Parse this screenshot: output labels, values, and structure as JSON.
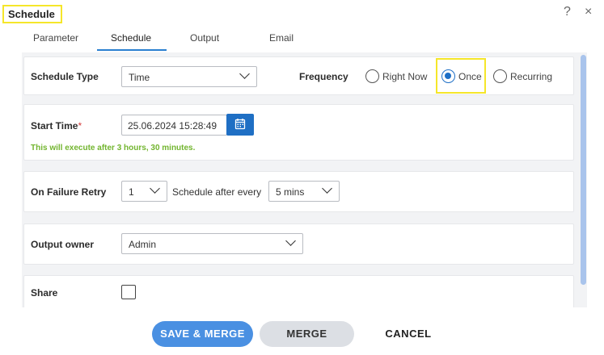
{
  "dialog": {
    "title": "Schedule",
    "help_icon": "?",
    "close_icon": "×"
  },
  "tabs": [
    {
      "label": "Parameter",
      "active": false
    },
    {
      "label": "Schedule",
      "active": true
    },
    {
      "label": "Output",
      "active": false
    },
    {
      "label": "Email",
      "active": false
    }
  ],
  "schedule_type": {
    "label": "Schedule Type",
    "value": "Time"
  },
  "frequency": {
    "label": "Frequency",
    "options": [
      {
        "label": "Right Now",
        "checked": false
      },
      {
        "label": "Once",
        "checked": true
      },
      {
        "label": "Recurring",
        "checked": false
      }
    ]
  },
  "start_time": {
    "label": "Start Time",
    "required_mark": "*",
    "value": "25.06.2024 15:28:49",
    "hint": "This will execute after 3 hours, 30 minutes."
  },
  "failure_retry": {
    "label": "On Failure Retry",
    "retry_value": "1",
    "schedule_after_label": "Schedule after every",
    "interval_value": "5 mins"
  },
  "output_owner": {
    "label": "Output owner",
    "value": "Admin"
  },
  "share": {
    "label": "Share",
    "checked": false
  },
  "footer": {
    "save_merge_label": "SAVE & MERGE",
    "merge_label": "MERGE",
    "cancel_label": "CANCEL"
  },
  "colors": {
    "accent": "#1f6fc4",
    "highlight": "#f5e62a",
    "hint": "#72b52f",
    "required": "#d43d3d"
  }
}
